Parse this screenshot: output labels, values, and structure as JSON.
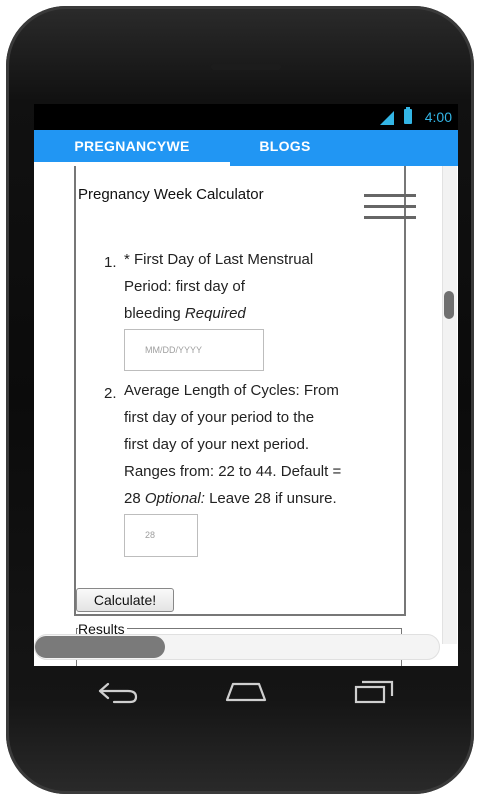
{
  "status": {
    "time": "4:00"
  },
  "tabs": [
    {
      "label": "PREGNANCYWE"
    },
    {
      "label": "BLOGS"
    }
  ],
  "page": {
    "title": "Pregnancy Week Calculator",
    "items": [
      {
        "number": "1.",
        "line1": "* First Day of Last Menstrual",
        "line2": "Period: first day of",
        "line3": "bleeding",
        "suffix": "Required",
        "placeholder": "MM/DD/YYYY"
      },
      {
        "number": "2.",
        "line1": "Average Length of Cycles: From",
        "line2": "first day of your period to the",
        "line3": "first day of your next period.",
        "line4": "Ranges from: 22 to 44. Default =",
        "line5a": "28",
        "line5b": "Optional:",
        "line5c": "Leave 28 if unsure.",
        "placeholder": "28"
      }
    ],
    "calculate_label": "Calculate!",
    "results_label": "Results"
  },
  "colors": {
    "accent": "#2196f3",
    "status_icon": "#33b5e5"
  },
  "icons": [
    "signal-icon",
    "battery-icon",
    "menu-icon",
    "back-icon",
    "home-icon",
    "recent-apps-icon"
  ]
}
